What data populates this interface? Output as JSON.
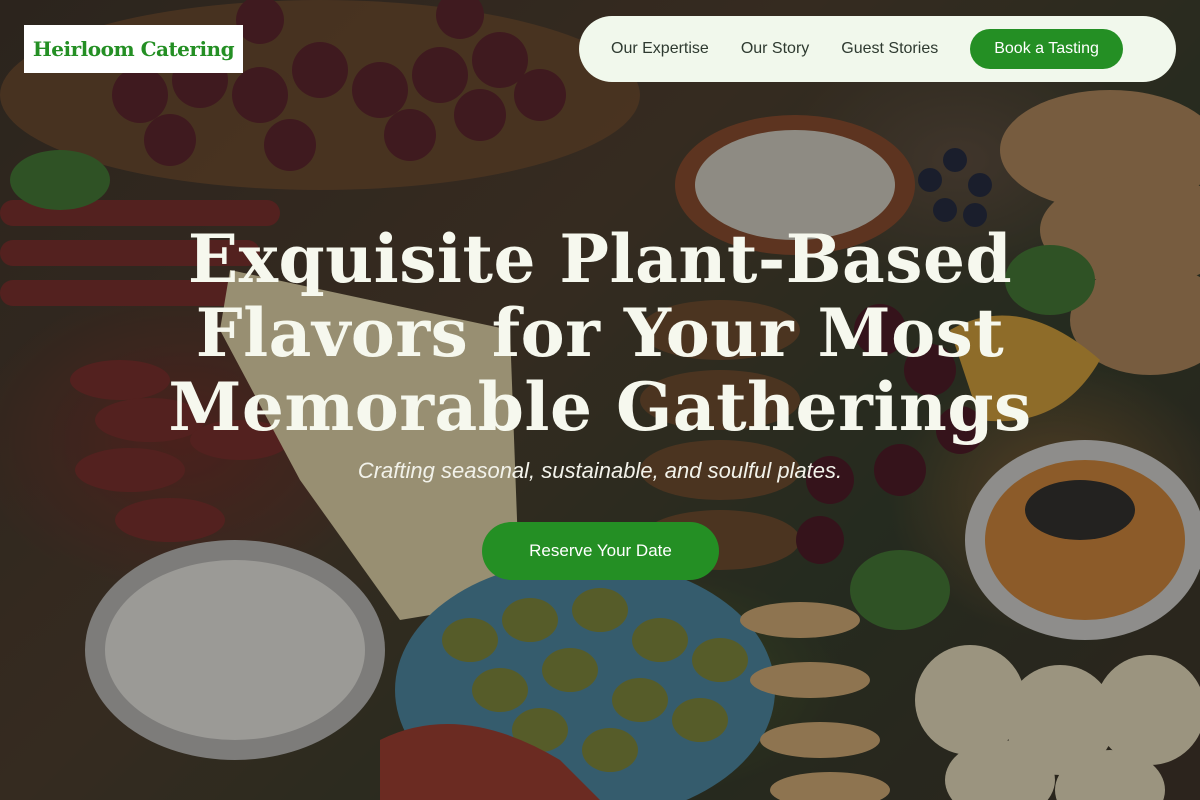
{
  "brand": {
    "name": "Heirloom Catering",
    "accent_color": "#248f24",
    "nav_background": "#f1f8ec"
  },
  "nav": {
    "links": [
      {
        "label": "Our Expertise"
      },
      {
        "label": "Our Story"
      },
      {
        "label": "Guest Stories"
      }
    ],
    "cta_label": "Book a Tasting"
  },
  "hero": {
    "title": "Exquisite Plant-Based Flavors for Your Most Memorable Gatherings",
    "subtitle": "Crafting seasonal, sustainable, and soulful plates.",
    "cta_label": "Reserve Your Date",
    "background_image": "charcuterie-board-photo"
  }
}
